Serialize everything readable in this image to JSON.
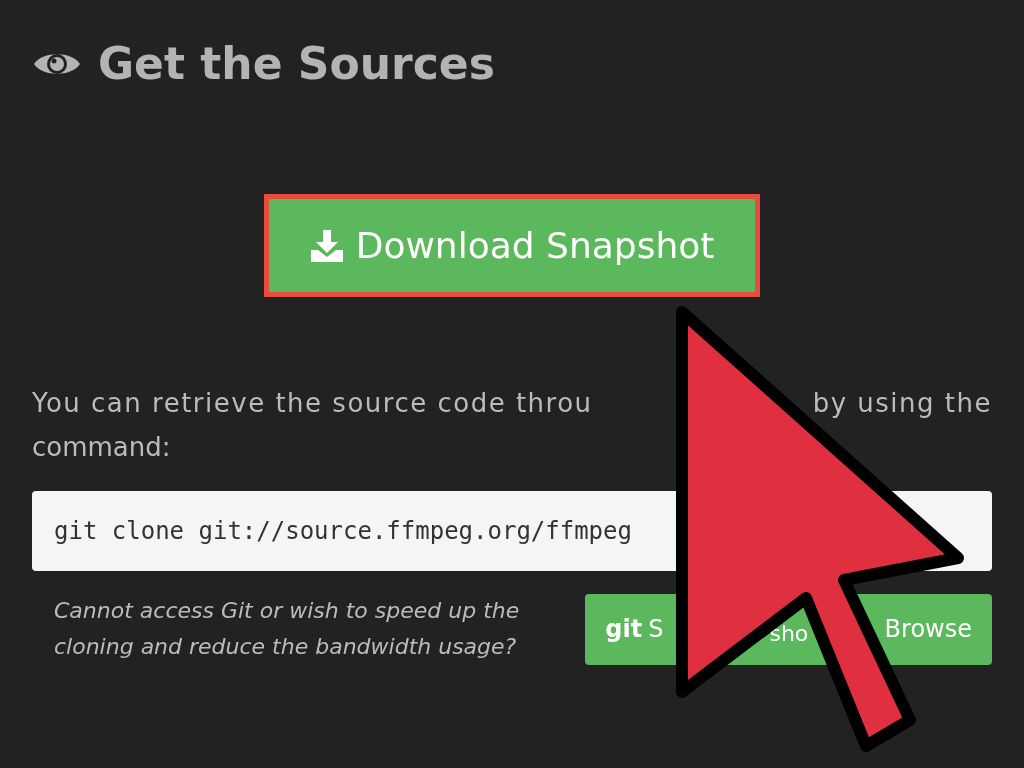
{
  "heading": "Get the Sources",
  "download_button": {
    "label": "Download Snapshot",
    "highlighted": true
  },
  "paragraph": {
    "visible_start": "You can retrieve the source code throu",
    "visible_end": "by using the",
    "second_line": "command:"
  },
  "code": "git clone git://source.ffmpeg.org/ffmpeg",
  "hint": [
    "Cannot access Git or wish to speed up the",
    "cloning and reduce the bandwidth usage?"
  ],
  "button_group": {
    "logo": "git",
    "fragments": [
      "S",
      "sho"
    ],
    "browse": "Browse"
  }
}
